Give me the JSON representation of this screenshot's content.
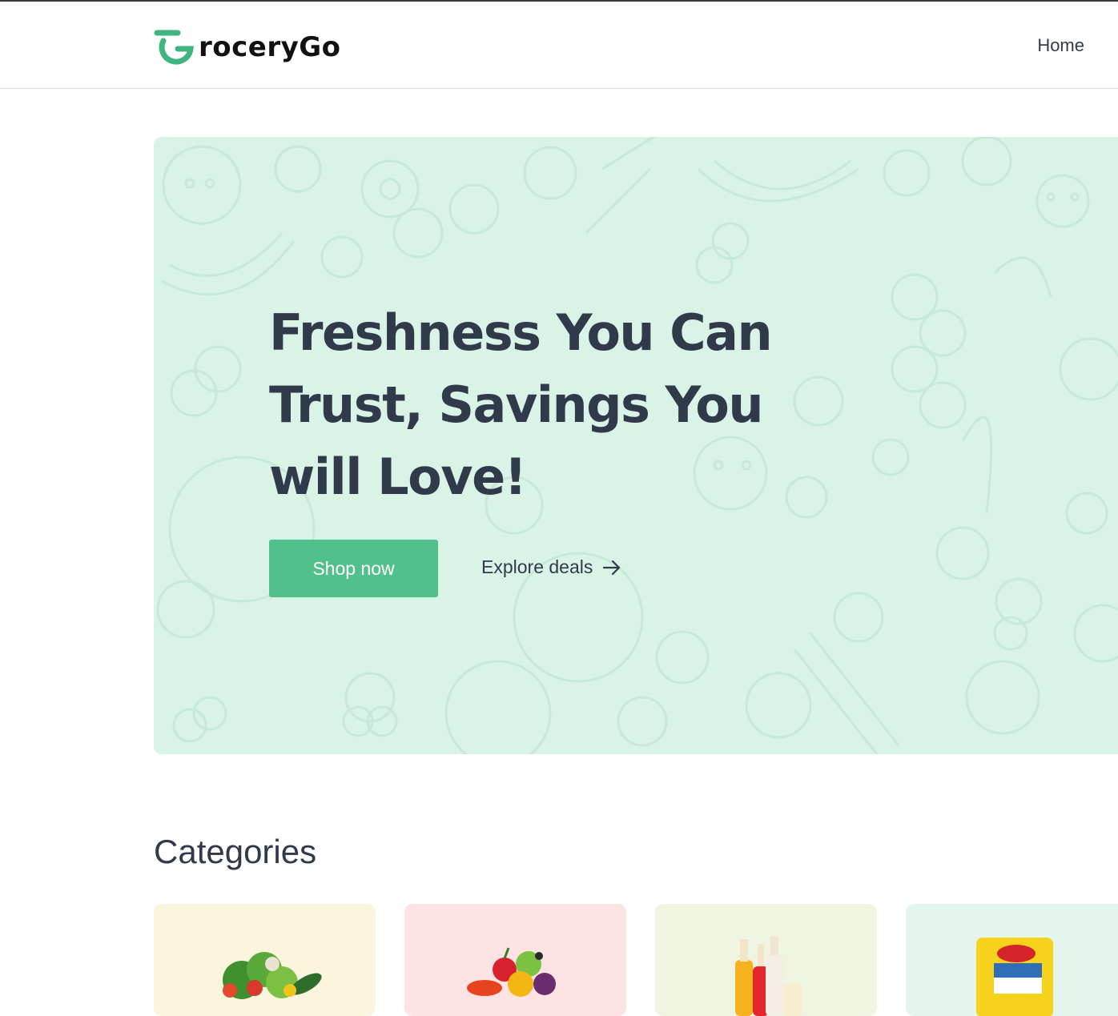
{
  "header": {
    "logo_text": "roceryGo",
    "nav": {
      "home_label": "Home"
    }
  },
  "hero": {
    "title": "Freshness You Can Trust, Savings You will Love!",
    "primary_button": "Shop now",
    "secondary_link": "Explore deals",
    "background_color": "#d9f3e6",
    "accent_color": "#52c08a"
  },
  "categories": {
    "title": "Categories",
    "cards": [
      {
        "bg_color": "#fbf5de",
        "icon": "vegetables-image"
      },
      {
        "bg_color": "#fde3e4",
        "icon": "fruits-image"
      },
      {
        "bg_color": "#f0f5e2",
        "icon": "beverages-image"
      },
      {
        "bg_color": "#e3f5ec",
        "icon": "instant-noodles-image"
      }
    ]
  }
}
